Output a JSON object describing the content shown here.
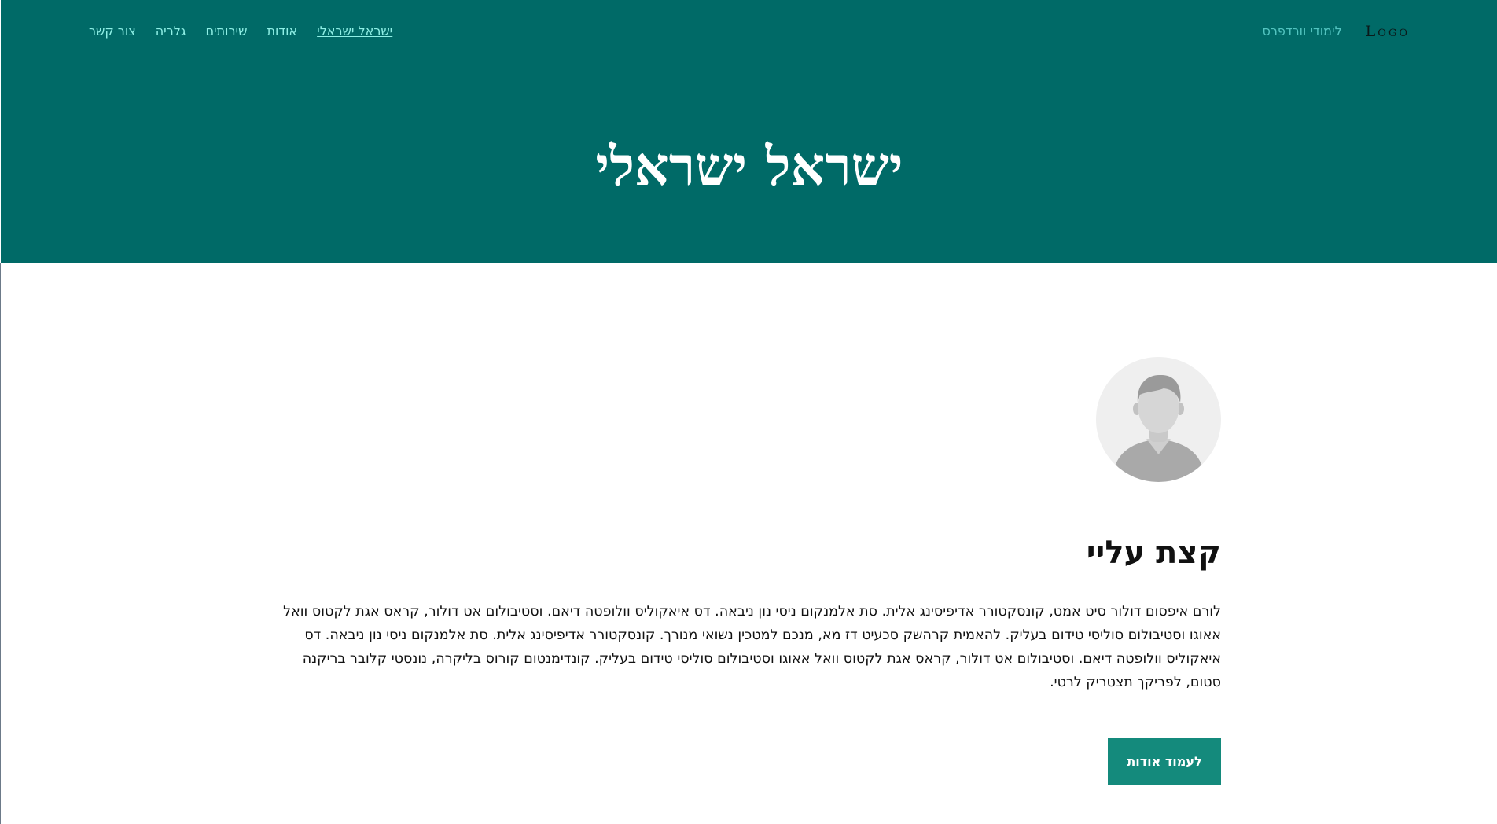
{
  "header": {
    "logo_text": "Logo",
    "site_link": "לימודי וורדפרס",
    "nav": {
      "items": [
        "צור קשר",
        "גלריה",
        "שירותים",
        "אודות",
        "ישראל ישראלי"
      ],
      "active_index": 4
    },
    "hero_title": "ישראל ישראלי"
  },
  "about": {
    "avatar_icon": "user-avatar-placeholder",
    "title": "קצת עליי",
    "bio": "לורם איפסום דולור סיט אמט, קונסקטורר אדיפיסינג אלית. סת אלמנקום ניסי נון ניבאה. דס איאקוליס וולופטה דיאם. וסטיבולום אט דולור, קראס אגת לקטוס וואל אאוגו וסטיבולום סוליסי טידום בעליק. להאמית קרהשק סכעיט דז מא, מנכם למטכין נשואי מנורך. קונסקטורר אדיפיסינג אלית. סת אלמנקום ניסי נון ניבאה. דס איאקוליס וולופטה דיאם. וסטיבולום אט דולור, קראס אגת לקטוס וואל אאוגו וסטיבולום סוליסי טידום בעליק. קונדימנטום קורוס בליקרה, נונסטי קלובר בריקנה סטום, לפריקך תצטריק לרטי.",
    "button_label": "לעמוד אודות"
  },
  "colors": {
    "header_bg": "#006a67",
    "nav_link": "#8ff0e6",
    "button_bg": "#148a7c",
    "text": "#111111"
  }
}
